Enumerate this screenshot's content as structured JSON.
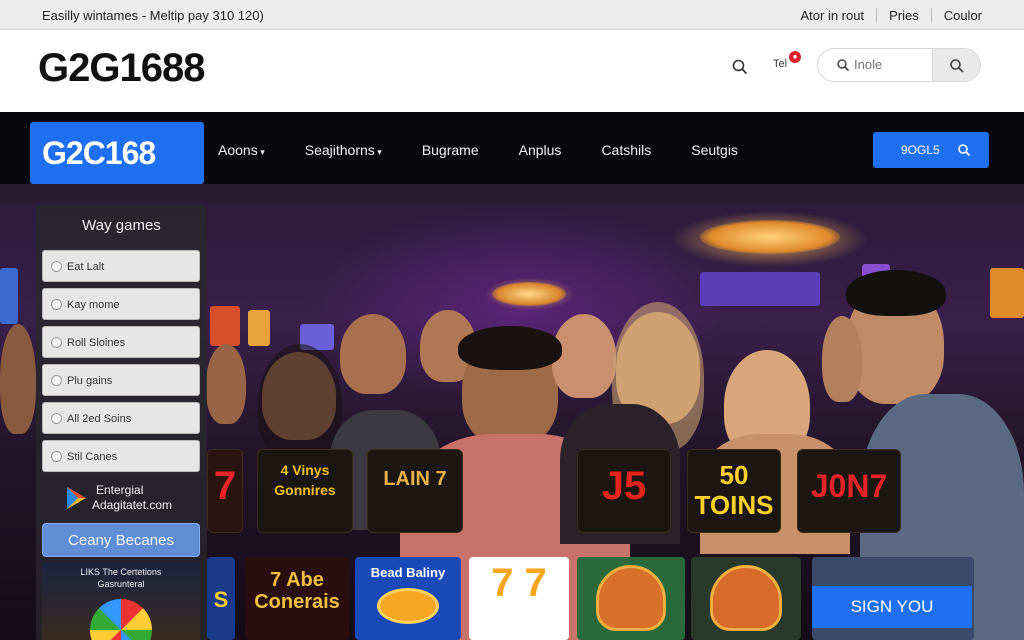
{
  "topbar": {
    "promo_text": "Easilly wintames - Meltip pay 310 120)",
    "links": [
      "Ator in rout",
      "Pries",
      "Coulor"
    ]
  },
  "header": {
    "logo": "G2G1688",
    "notification_label": "Tel",
    "search_placeholder": "Inole"
  },
  "nav": {
    "logo": "G2C168",
    "items": [
      "Aoons",
      "Seajithorns",
      "Bugrame",
      "Anplus",
      "Catshils",
      "Seutgis"
    ],
    "button_label": "9OGL5"
  },
  "sidebar": {
    "title": "Way games",
    "items": [
      "Eat Lalt",
      "Kay mome",
      "Roll Sloines",
      "Plu gains",
      "All 2ed Soins",
      "Stil Canes"
    ],
    "promo_line1": "Entergial",
    "promo_line2": "Adagitatet.com",
    "cta_label": "Ceany Becanes",
    "footer_line1": "LIKS The Certetions",
    "footer_line2": "Gasrunteral"
  },
  "game_tiles_top": [
    {
      "text": "7"
    },
    {
      "text": "4 Vinys Gonnires"
    },
    {
      "text": "LAIN 7"
    },
    {
      "text": "J5"
    },
    {
      "text": "50 TOINS"
    },
    {
      "text": "J0N7"
    }
  ],
  "game_tiles_bottom": [
    {
      "text": "S"
    },
    {
      "text": "7 Abe Conerais"
    },
    {
      "text": "Bead Baliny"
    },
    {
      "text": "7 7"
    },
    {
      "text": ""
    },
    {
      "text": ""
    },
    {
      "text": ""
    }
  ],
  "signup_label": "SIGN YOU",
  "colors": {
    "brand_blue": "#1f6ff2",
    "nav_bg": "#08080a",
    "notif_red": "#e0202a"
  }
}
